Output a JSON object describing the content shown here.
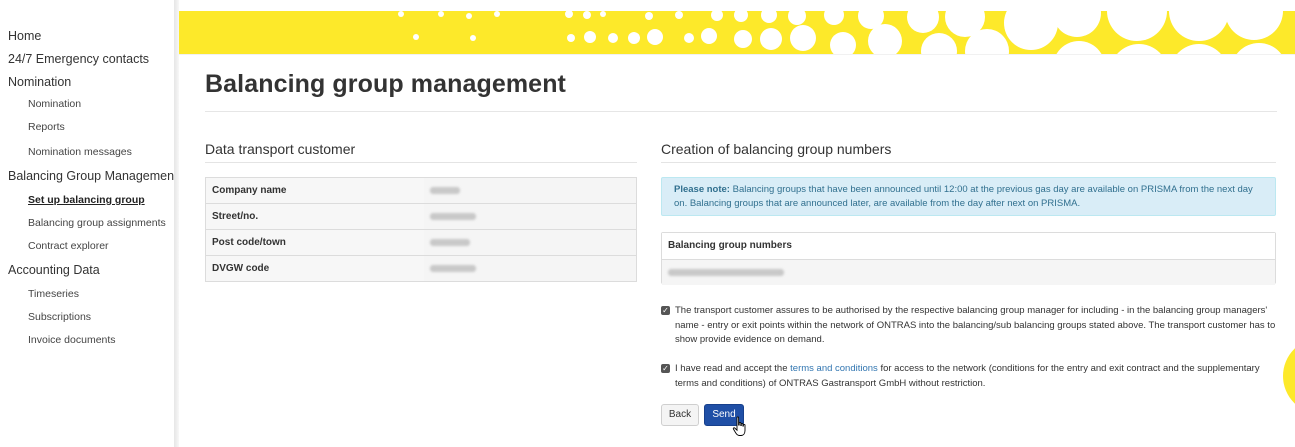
{
  "sidebar": {
    "items": [
      {
        "label": "Home",
        "level": "top"
      },
      {
        "label": "24/7 Emergency contacts",
        "level": "top"
      },
      {
        "label": "Nomination",
        "level": "top"
      },
      {
        "label": "Nomination",
        "level": "sub"
      },
      {
        "label": "Reports",
        "level": "sub"
      },
      {
        "label": "Nomination messages",
        "level": "sub"
      },
      {
        "label": "Balancing Group Management",
        "level": "top"
      },
      {
        "label": "Set up balancing group",
        "level": "sub",
        "active": true
      },
      {
        "label": "Balancing group assignments",
        "level": "sub"
      },
      {
        "label": "Contract explorer",
        "level": "sub"
      },
      {
        "label": "Accounting Data",
        "level": "top"
      },
      {
        "label": "Timeseries",
        "level": "sub"
      },
      {
        "label": "Subscriptions",
        "level": "sub"
      },
      {
        "label": "Invoice documents",
        "level": "sub"
      }
    ]
  },
  "main": {
    "title": "Balancing group management",
    "customer": {
      "title": "Data transport customer",
      "rows": [
        {
          "label": "Company name"
        },
        {
          "label": "Street/no."
        },
        {
          "label": "Post code/town"
        },
        {
          "label": "DVGW code"
        }
      ]
    },
    "creation": {
      "title": "Creation of balancing group numbers",
      "note_strong": "Please note:",
      "note_text": " Balancing groups that have been announced until 12:00 at the previous gas day are available on PRISMA from the next day on. Balancing groups that are announced later, are available from the day after next on PRISMA.",
      "numbers_header": "Balancing group numbers",
      "check1": "The transport customer assures to be authorised by the respective balancing group manager for including - in the balancing group managers' name - entry or exit points within the network of ONTRAS into the balancing/sub balancing groups stated above. The transport customer has to show provide evidence on demand.",
      "check2_before": "I have read and accept the ",
      "check2_link": "terms and conditions",
      "check2_after": " for access to the network (conditions for the entry and exit contract and the supplementary terms and conditions) of ONTRAS Gastransport GmbH without restriction.",
      "check1_checked": true,
      "check2_checked": true,
      "back_label": "Back",
      "send_label": "Send"
    }
  },
  "colors": {
    "banner": "#fde92a",
    "primary_button": "#1f4fa6",
    "note_background": "#d9edf7",
    "note_text": "#31708f",
    "link": "#3276b1"
  }
}
